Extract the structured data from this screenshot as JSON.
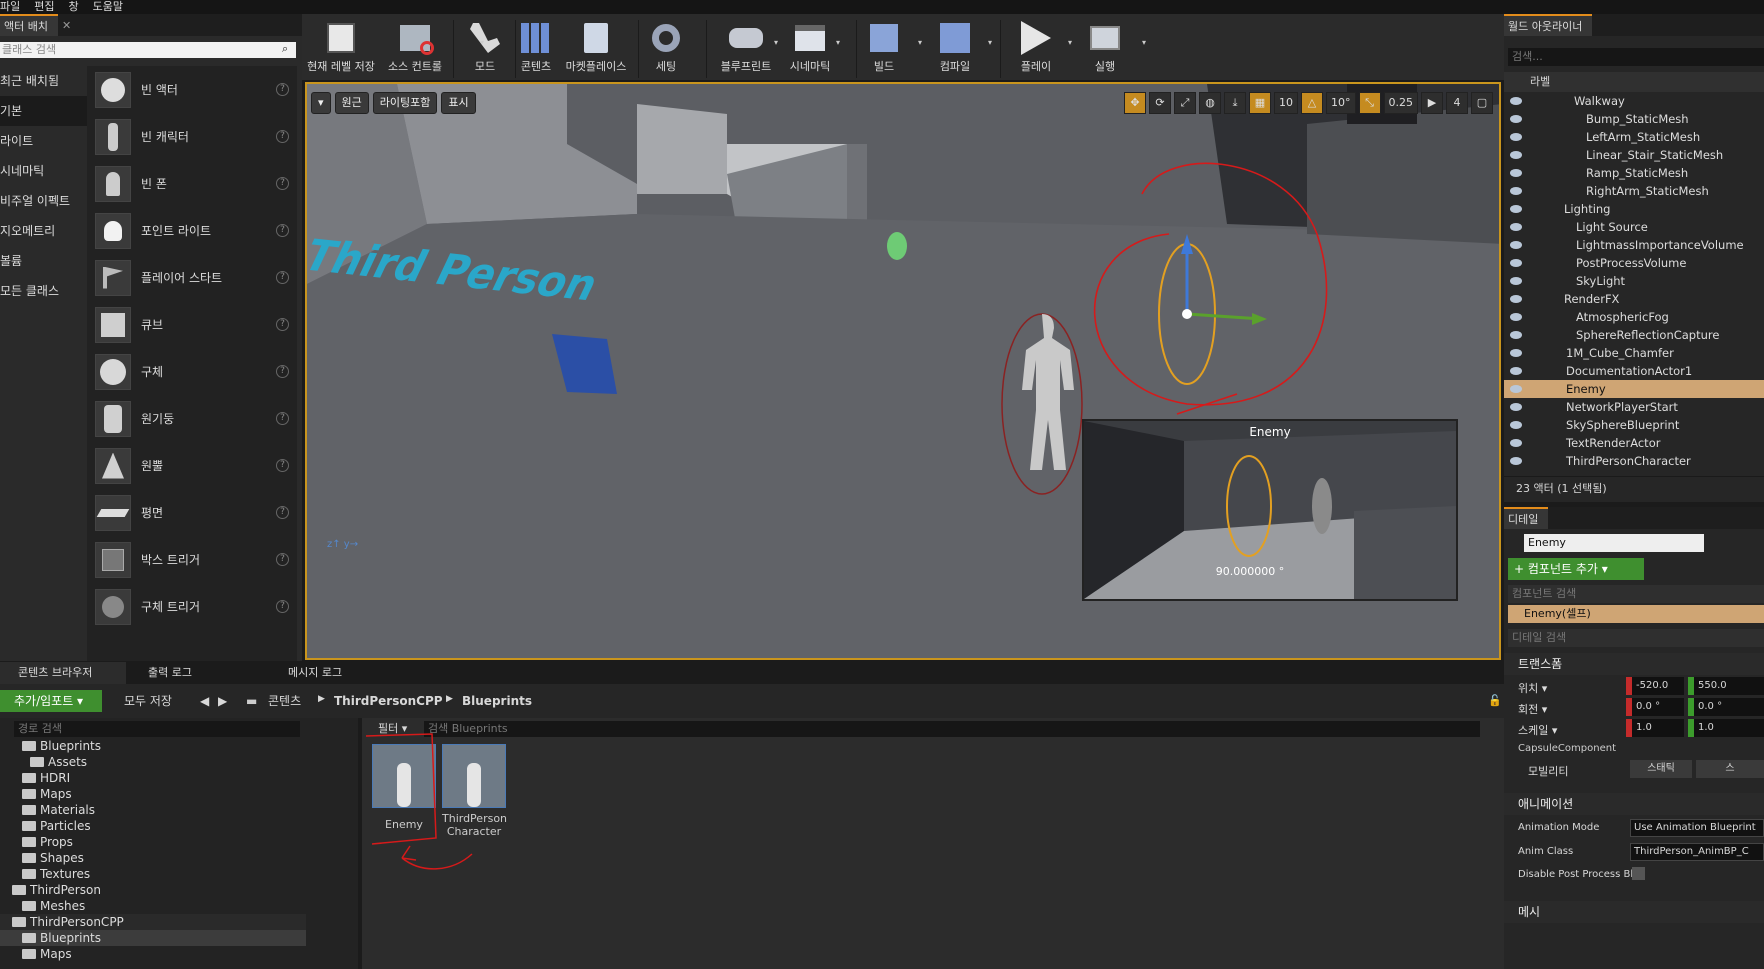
{
  "menu": [
    "파일",
    "편집",
    "창",
    "도움말"
  ],
  "place": {
    "tab": "액터 배치",
    "search_placeholder": "클래스 검색",
    "categories": [
      "최근 배치됨",
      "기본",
      "라이트",
      "시네마틱",
      "비주얼 이펙트",
      "지오메트리",
      "볼륨",
      "모든 클래스"
    ],
    "items": [
      "빈 액터",
      "빈 캐릭터",
      "빈 폰",
      "포인트 라이트",
      "플레이어 스타트",
      "큐브",
      "구체",
      "원기둥",
      "원뿔",
      "평면",
      "박스 트리거",
      "구체 트리거"
    ]
  },
  "toolbar": [
    "현재 레벨 저장",
    "소스 컨트롤",
    "모드",
    "콘텐츠",
    "마켓플레이스",
    "세팅",
    "블루프린트",
    "시네마틱",
    "빌드",
    "컴파일",
    "플레이",
    "실행"
  ],
  "viewport": {
    "left_buttons": [
      "원근",
      "라이팅포함",
      "표시"
    ],
    "snap": [
      "10",
      "10°",
      "0.25",
      "4"
    ],
    "floor_text": "Third Person",
    "preview_title": "Enemy",
    "preview_value": "90.000000 °"
  },
  "outliner": {
    "tab": "월드 아웃라이너",
    "search_placeholder": "검색...",
    "column": "라벨",
    "rows": [
      "Walkway",
      "Bump_StaticMesh",
      "LeftArm_StaticMesh",
      "Linear_Stair_StaticMesh",
      "Ramp_StaticMesh",
      "RightArm_StaticMesh",
      "Lighting",
      "Light Source",
      "LightmassImportanceVolume",
      "PostProcessVolume",
      "SkyLight",
      "RenderFX",
      "AtmosphericFog",
      "SphereReflectionCapture",
      "1M_Cube_Chamfer",
      "DocumentationActor1",
      "Enemy",
      "NetworkPlayerStart",
      "SkySphereBlueprint",
      "TextRenderActor",
      "ThirdPersonCharacter"
    ],
    "count": "23 액터 (1 선택됨)"
  },
  "details": {
    "tab": "디테일",
    "name": "Enemy",
    "add_component": "+ 컴포넌트 추가 ▾",
    "component_search": "컴포넌트 검색",
    "self": "Enemy(셀프)",
    "detail_search": "디테일 검색",
    "transform": "트랜스폼",
    "location": "위치 ▾",
    "rotation": "회전 ▾",
    "scale": "스케일 ▾",
    "loc_x": "-520.0",
    "loc_y": "550.0",
    "rot_x": "0.0 °",
    "rot_y": "0.0 °",
    "scl_x": "1.0",
    "scl_y": "1.0",
    "capsule": "CapsuleComponent",
    "mobility": "모빌리티",
    "static": "스태틱",
    "movable": "스",
    "animation": "애니메이션",
    "anim_mode_label": "Animation Mode",
    "anim_mode_value": "Use Animation Blueprint",
    "anim_class_label": "Anim Class",
    "anim_class_value": "ThirdPerson_AnimBP_C",
    "disable_pp": "Disable Post Process Bl",
    "mesh": "메시"
  },
  "bottom_tabs": [
    "콘텐츠 브라우저",
    "출력 로그",
    "메시지 로그"
  ],
  "content_browser": {
    "add_import": "추가/임포트 ▾",
    "save_all": "모두 저장",
    "path": [
      "콘텐츠",
      "ThirdPersonCPP",
      "Blueprints"
    ],
    "path_search": "경로 검색",
    "filter": "필터 ▾",
    "asset_search": "검색 Blueprints",
    "tree": [
      "Blueprints",
      "Assets",
      "HDRI",
      "Maps",
      "Materials",
      "Particles",
      "Props",
      "Shapes",
      "Textures",
      "ThirdPerson",
      "Meshes",
      "ThirdPersonCPP",
      "Blueprints",
      "Maps"
    ],
    "assets": [
      "Enemy",
      "ThirdPerson Character"
    ]
  }
}
